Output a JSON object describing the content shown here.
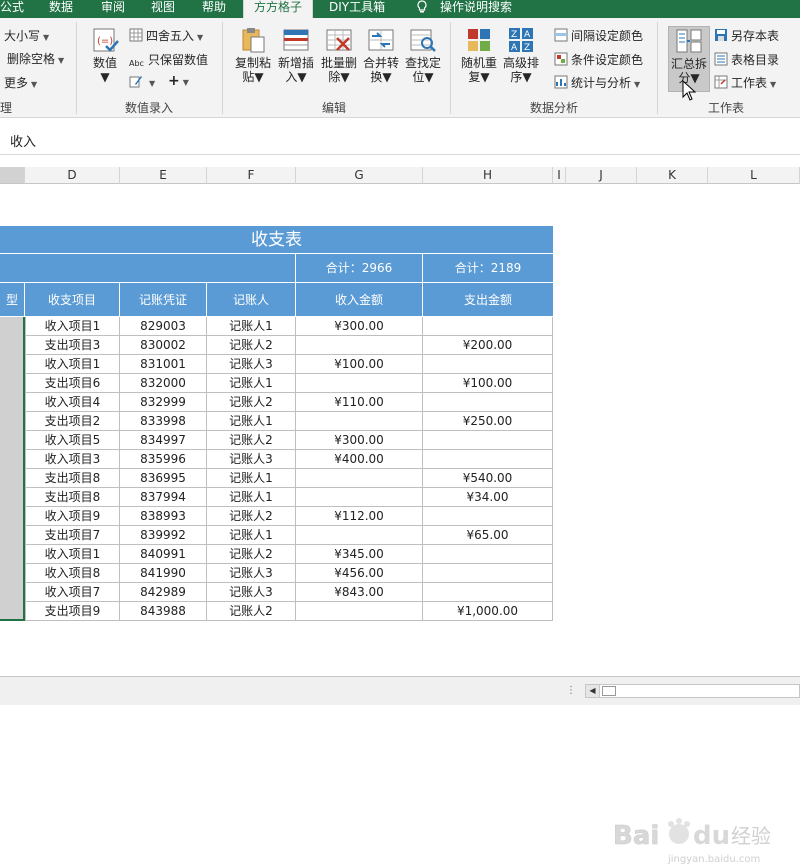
{
  "ribbon_tabs": [
    {
      "label": "公式"
    },
    {
      "label": "数据"
    },
    {
      "label": "审阅"
    },
    {
      "label": "视图"
    },
    {
      "label": "帮助"
    },
    {
      "label": "方方格子",
      "active": true
    },
    {
      "label": "DIY工具箱"
    },
    {
      "label": "操作说明搜索"
    }
  ],
  "ribbon": {
    "group1": {
      "items": [
        {
          "label": "大小写"
        },
        {
          "label": "删除空格"
        },
        {
          "label": "更多"
        }
      ],
      "title": "理"
    },
    "group2": {
      "value_btn": "数值",
      "round_label": "四舍五入",
      "keep_label": "只保留数值",
      "small_plus": "+",
      "title": "数值录入"
    },
    "group3": {
      "buttons": [
        {
          "label1": "复制粘",
          "label2": "贴"
        },
        {
          "label1": "新增插",
          "label2": "入"
        },
        {
          "label1": "批量删",
          "label2": "除"
        },
        {
          "label1": "合并转",
          "label2": "换"
        },
        {
          "label1": "查找定",
          "label2": "位"
        }
      ],
      "title": "编辑"
    },
    "group4": {
      "buttons": [
        {
          "label1": "随机重",
          "label2": "复"
        },
        {
          "label1": "高级排",
          "label2": "序"
        }
      ],
      "items": [
        {
          "label": "间隔设定颜色"
        },
        {
          "label": "条件设定颜色"
        },
        {
          "label": "统计与分析"
        }
      ],
      "title": "数据分析"
    },
    "group5": {
      "big_btn": {
        "label1": "汇总拆",
        "label2": "分"
      },
      "items": [
        {
          "label": "另存本表"
        },
        {
          "label": "表格目录"
        },
        {
          "label": "工作表"
        }
      ],
      "title": "工作表"
    }
  },
  "formula_bar": {
    "content": "收入"
  },
  "columns": [
    "D",
    "E",
    "F",
    "G",
    "H",
    "I",
    "J",
    "K",
    "L"
  ],
  "table": {
    "title": "收支表",
    "totals": {
      "income": "合计：2966",
      "expense": "合计：2189"
    },
    "partial_header": "型",
    "headers": [
      "收支项目",
      "记账凭证",
      "记账人",
      "收入金额",
      "支出金额"
    ],
    "rows": [
      [
        "收入项目1",
        "829003",
        "记账人1",
        "¥300.00",
        ""
      ],
      [
        "支出项目3",
        "830002",
        "记账人2",
        "",
        "¥200.00"
      ],
      [
        "收入项目1",
        "831001",
        "记账人3",
        "¥100.00",
        ""
      ],
      [
        "支出项目6",
        "832000",
        "记账人1",
        "",
        "¥100.00"
      ],
      [
        "收入项目4",
        "832999",
        "记账人2",
        "¥110.00",
        ""
      ],
      [
        "支出项目2",
        "833998",
        "记账人1",
        "",
        "¥250.00"
      ],
      [
        "收入项目5",
        "834997",
        "记账人2",
        "¥300.00",
        ""
      ],
      [
        "收入项目3",
        "835996",
        "记账人3",
        "¥400.00",
        ""
      ],
      [
        "支出项目8",
        "836995",
        "记账人1",
        "",
        "¥540.00"
      ],
      [
        "支出项目8",
        "837994",
        "记账人1",
        "",
        "¥34.00"
      ],
      [
        "收入项目9",
        "838993",
        "记账人2",
        "¥112.00",
        ""
      ],
      [
        "支出项目7",
        "839992",
        "记账人1",
        "",
        "¥65.00"
      ],
      [
        "收入项目1",
        "840991",
        "记账人2",
        "¥345.00",
        ""
      ],
      [
        "收入项目8",
        "841990",
        "记账人3",
        "¥456.00",
        ""
      ],
      [
        "收入项目7",
        "842989",
        "记账人3",
        "¥843.00",
        ""
      ],
      [
        "支出项目9",
        "843988",
        "记账人2",
        "",
        "¥1,000.00"
      ]
    ]
  },
  "watermark": {
    "text": "Bai du 经验",
    "sub": "jingyan.baidu.com"
  },
  "colors": {
    "excel_green": "#217346",
    "header_blue": "#5b9bd5"
  }
}
